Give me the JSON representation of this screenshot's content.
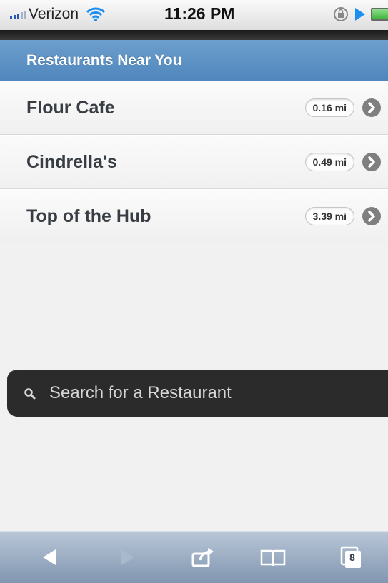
{
  "status_bar": {
    "carrier": "Verizon",
    "time": "11:26 PM"
  },
  "header": {
    "title": "Restaurants Near You"
  },
  "restaurants": [
    {
      "name": "Flour Cafe",
      "distance": "0.16 mi"
    },
    {
      "name": "Cindrella's",
      "distance": "0.49 mi"
    },
    {
      "name": "Top of the Hub",
      "distance": "3.39 mi"
    }
  ],
  "search": {
    "placeholder": "Search for a Restaurant"
  },
  "toolbar": {
    "pages_count": "8",
    "icons": [
      "back-arrow-icon",
      "forward-arrow-icon",
      "share-icon",
      "bookmarks-icon",
      "pages-icon"
    ]
  },
  "colors": {
    "header_blue": "#5a8fc4",
    "list_text": "#383d44",
    "search_bg": "#2b2b2b",
    "toolbar_blue": "#9aacc3"
  }
}
